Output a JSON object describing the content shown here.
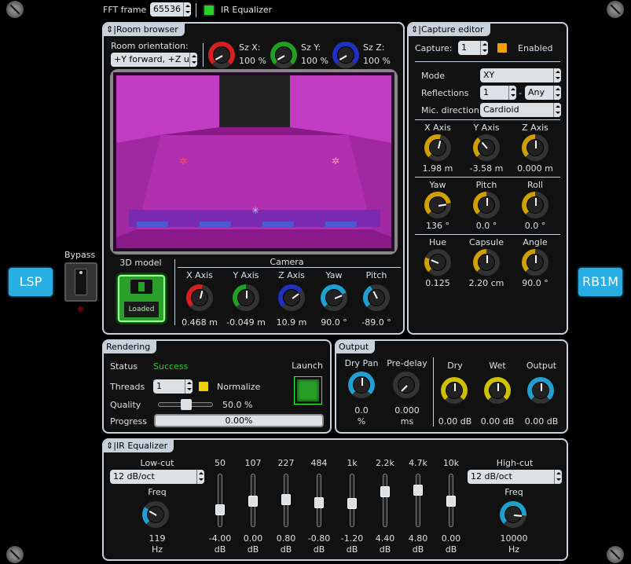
{
  "header": {
    "fft_label": "FFT frame",
    "fft_value": "65536",
    "ir_eq_label": "IR Equalizer"
  },
  "bypass": {
    "label": "Bypass"
  },
  "side": {
    "left": "LSP",
    "right": "RB1M"
  },
  "room": {
    "title": "Room browser",
    "orientation_label": "Room orientation:",
    "orientation_value": "+Y forward, +Z up",
    "sx_label": "Sz X:",
    "sx_value": "100 %",
    "sy_label": "Sz Y:",
    "sy_value": "100 %",
    "sz_label": "Sz Z:",
    "sz_value": "100 %",
    "model_label": "3D model",
    "model_status": "Loaded",
    "camera_label": "Camera",
    "cam": [
      {
        "label": "X Axis",
        "value": "0.468 m",
        "color": "#d42020"
      },
      {
        "label": "Y Axis",
        "value": "-0.049 m",
        "color": "#20a020"
      },
      {
        "label": "Z Axis",
        "value": "10.9 m",
        "color": "#2030c0"
      },
      {
        "label": "Yaw",
        "value": "90.0 °",
        "color": "#20a0d0"
      },
      {
        "label": "Pitch",
        "value": "-89.0 °",
        "color": "#20a0d0"
      }
    ]
  },
  "capture": {
    "title": "Capture editor",
    "capture_label": "Capture:",
    "capture_value": "1",
    "enabled_label": "Enabled",
    "mode_label": "Mode",
    "mode_value": "XY",
    "refl_label": "Reflections",
    "refl_min": "1",
    "refl_sep": "-",
    "refl_max": "Any",
    "mic_label": "Mic. direction",
    "mic_value": "Cardioid",
    "row1": [
      {
        "label": "X Axis",
        "value": "1.98 m"
      },
      {
        "label": "Y Axis",
        "value": "-3.58 m"
      },
      {
        "label": "Z Axis",
        "value": "0.000 m"
      }
    ],
    "row2": [
      {
        "label": "Yaw",
        "value": "136 °"
      },
      {
        "label": "Pitch",
        "value": "0.0 °"
      },
      {
        "label": "Roll",
        "value": "0.0 °"
      }
    ],
    "row3": [
      {
        "label": "Hue",
        "value": "0.125"
      },
      {
        "label": "Capsule",
        "value": "2.20 cm"
      },
      {
        "label": "Angle",
        "value": "90.0 °"
      }
    ]
  },
  "rendering": {
    "title": "Rendering",
    "status_label": "Status",
    "status_value": "Success",
    "launch_label": "Launch",
    "threads_label": "Threads",
    "threads_value": "1",
    "normalize_label": "Normalize",
    "quality_label": "Quality",
    "quality_value": "50.0 %",
    "progress_label": "Progress",
    "progress_value": "0.00%",
    "quality_level": 0.5
  },
  "output": {
    "title": "Output",
    "dry_pan_label": "Dry Pan",
    "dry_pan_value": "0.0",
    "dry_pan_unit": "%",
    "predelay_label": "Pre-delay",
    "predelay_value": "0.000",
    "predelay_unit": "ms",
    "dry_label": "Dry",
    "dry_value": "0.00 dB",
    "wet_label": "Wet",
    "wet_value": "0.00 dB",
    "out_label": "Output",
    "out_value": "0.00 dB"
  },
  "eq": {
    "title": "IR Equalizer",
    "lowcut_label": "Low-cut",
    "lowcut_value": "12 dB/oct",
    "lowfreq_label": "Freq",
    "lowfreq_value": "119",
    "lowfreq_unit": "Hz",
    "highcut_label": "High-cut",
    "highcut_value": "12 dB/oct",
    "highfreq_label": "Freq",
    "highfreq_value": "10000",
    "highfreq_unit": "Hz",
    "bands": [
      {
        "label": "50",
        "value": "-4.00",
        "unit": "dB",
        "gain": -4
      },
      {
        "label": "107",
        "value": "0.00",
        "unit": "dB",
        "gain": 0
      },
      {
        "label": "227",
        "value": "0.80",
        "unit": "dB",
        "gain": 0.8
      },
      {
        "label": "484",
        "value": "-0.80",
        "unit": "dB",
        "gain": -0.8
      },
      {
        "label": "1k",
        "value": "-1.20",
        "unit": "dB",
        "gain": -1.2
      },
      {
        "label": "2.2k",
        "value": "4.40",
        "unit": "dB",
        "gain": 4.4
      },
      {
        "label": "4.7k",
        "value": "4.80",
        "unit": "dB",
        "gain": 4.8
      },
      {
        "label": "10k",
        "value": "0.00",
        "unit": "dB",
        "gain": 0
      }
    ]
  }
}
